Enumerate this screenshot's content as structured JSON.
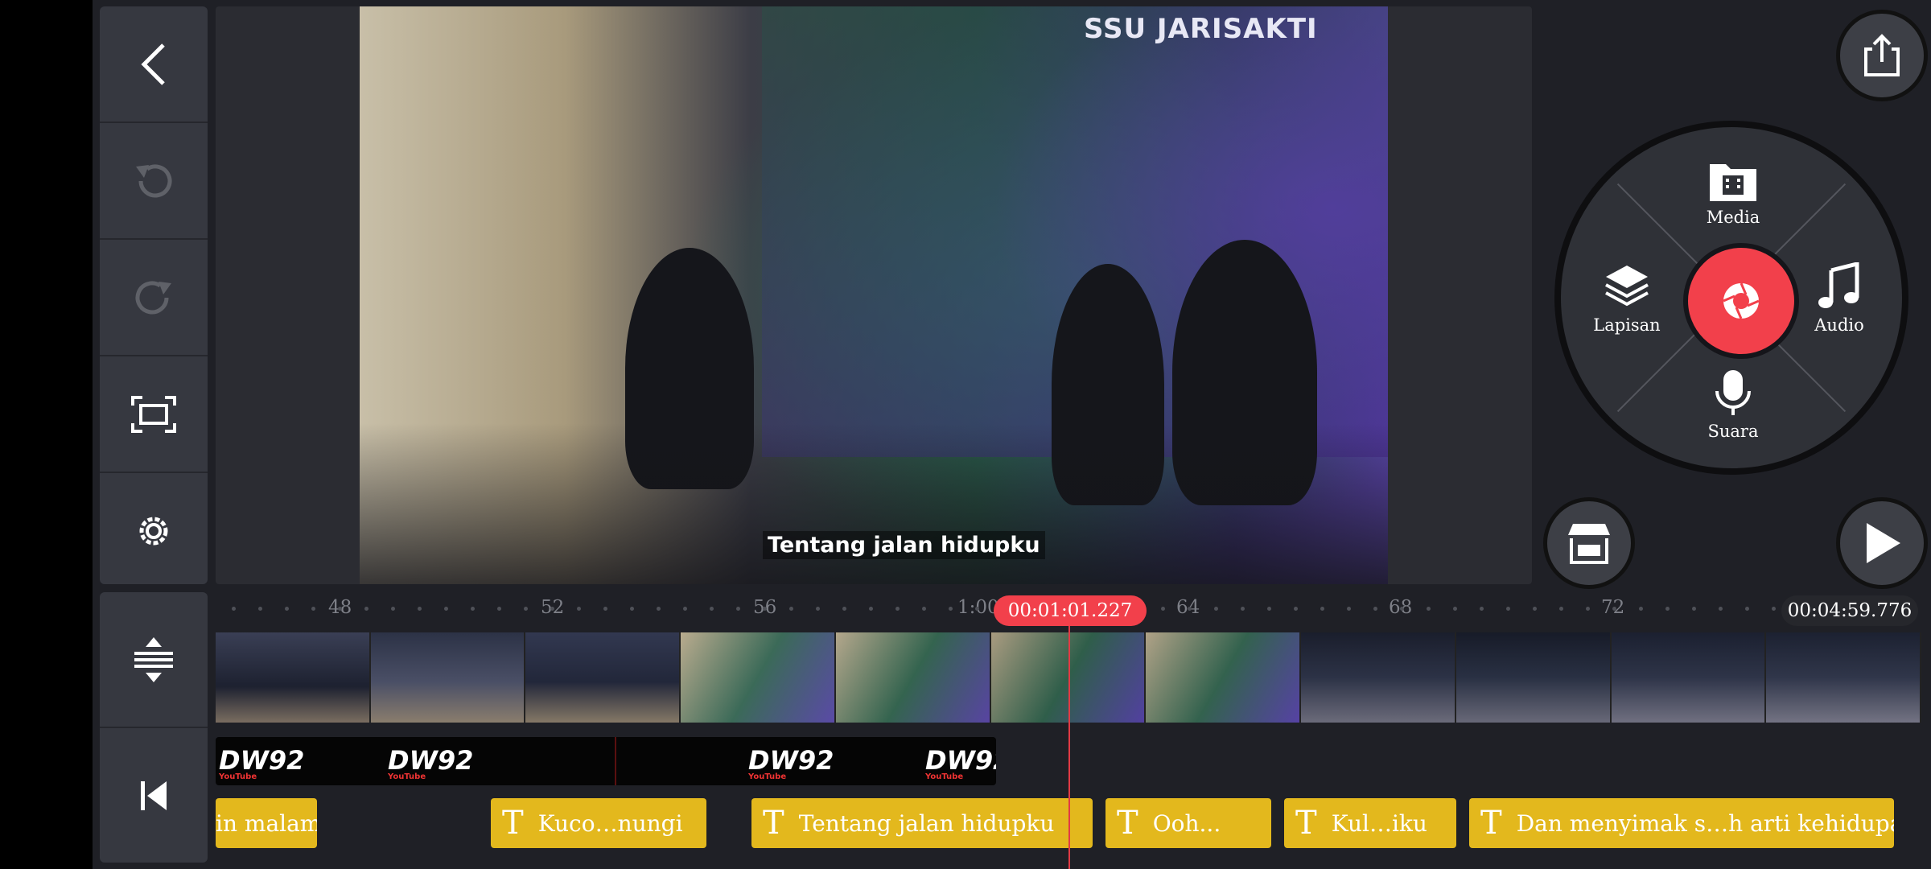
{
  "preview": {
    "subtitle": "Tentang jalan hidupku",
    "banner_text": "SSU JARISAKTI"
  },
  "toolbar": {
    "back": "chevron-left-icon",
    "undo": "undo-icon",
    "redo": "redo-icon",
    "fit": "fit-screen-icon",
    "settings": "gear-icon",
    "adjust": "adjust-track-height-icon",
    "to_start": "skip-to-start-icon"
  },
  "controls": {
    "share": "share-icon",
    "store": "store-icon",
    "play": "play-icon"
  },
  "wheel": {
    "media_label": "Media",
    "layer_label": "Lapisan",
    "audio_label": "Audio",
    "voice_label": "Suara",
    "record": "record-icon"
  },
  "timeline": {
    "ticks": [
      "48",
      "52",
      "56",
      "1:00",
      "64",
      "68",
      "72"
    ],
    "playhead_time": "00:01:01.227",
    "total_time": "00:04:59.776",
    "logo_text": "DW92",
    "logo_sub": "YouTube",
    "text_clips": [
      "in malam",
      "Kuco…nungi",
      "Tentang jalan hidupku",
      "Ooh...",
      "Kul…iku",
      "Dan menyimak s…h arti kehidupan"
    ]
  },
  "colors": {
    "accent": "#f2404b",
    "text_clip": "#e3b81d",
    "panel": "#363840"
  }
}
